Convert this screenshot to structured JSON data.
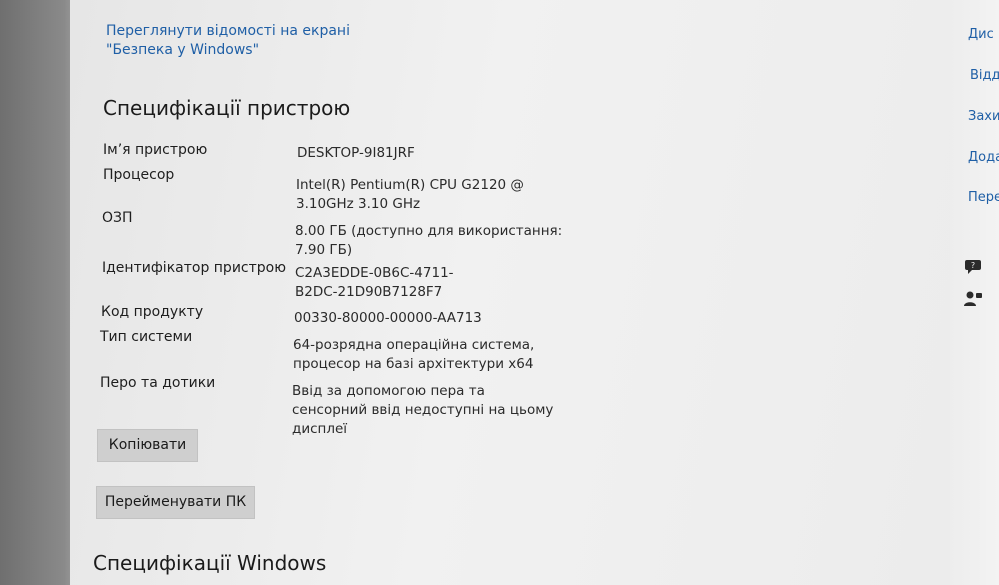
{
  "security_link": "Переглянути відомості на екрані \"Безпека у Windows\"",
  "device_specs": {
    "title": "Специфікації пристрою",
    "rows": [
      {
        "label": "Ім’я пристрою",
        "value": "DESKTOP-9I81JRF"
      },
      {
        "label": "Процесор",
        "value": "Intel(R) Pentium(R) CPU G2120 @ 3.10GHz 3.10 GHz"
      },
      {
        "label": "ОЗП",
        "value": "8.00 ГБ (доступно для використання: 7.90 ГБ)"
      },
      {
        "label": "Ідентифікатор пристрою",
        "value": "C2A3EDDE-0B6C-4711-B2DC-21D90B7128F7"
      },
      {
        "label": "Код продукту",
        "value": "00330-80000-00000-AA713"
      },
      {
        "label": "Тип системи",
        "value": "64-розрядна операційна система, процесор на базі архітектури x64"
      },
      {
        "label": "Перо та дотики",
        "value": "Ввід за допомогою пера та сенсорний ввід недоступні на цьому дисплеї"
      }
    ]
  },
  "buttons": {
    "copy": "Копіювати",
    "rename": "Перейменувати ПК"
  },
  "windows_specs": {
    "title": "Специфікації Windows"
  },
  "right_panel": {
    "items": [
      "Дис",
      "Відд",
      "Захи",
      "Дода",
      "Пере"
    ],
    "icons": [
      "help-icon",
      "feedback-icon"
    ]
  }
}
